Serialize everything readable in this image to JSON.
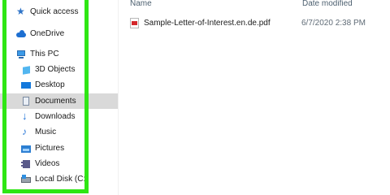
{
  "nav": {
    "items": [
      {
        "label": "Quick access",
        "icon": "star-icon"
      },
      {
        "label": "OneDrive",
        "icon": "cloud-icon"
      },
      {
        "label": "This PC",
        "icon": "computer-icon"
      },
      {
        "label": "3D Objects",
        "icon": "cube-icon"
      },
      {
        "label": "Desktop",
        "icon": "desktop-icon"
      },
      {
        "label": "Documents",
        "icon": "document-icon",
        "selected": true
      },
      {
        "label": "Downloads",
        "icon": "download-arrow-icon"
      },
      {
        "label": "Music",
        "icon": "music-note-icon"
      },
      {
        "label": "Pictures",
        "icon": "picture-icon"
      },
      {
        "label": "Videos",
        "icon": "video-icon"
      },
      {
        "label": "Local Disk (C:)",
        "icon": "disk-drive-icon"
      }
    ]
  },
  "columns": {
    "name": "Name",
    "date_modified": "Date modified"
  },
  "files": [
    {
      "name": "Sample-Letter-of-Interest.en.de.pdf",
      "date_modified": "6/7/2020 2:38 PM",
      "icon": "pdf-file-icon"
    }
  ],
  "colors": {
    "highlight_frame": "#2fe614",
    "selected_bg": "#d9d9d9",
    "accent": "#1d6fd1"
  }
}
